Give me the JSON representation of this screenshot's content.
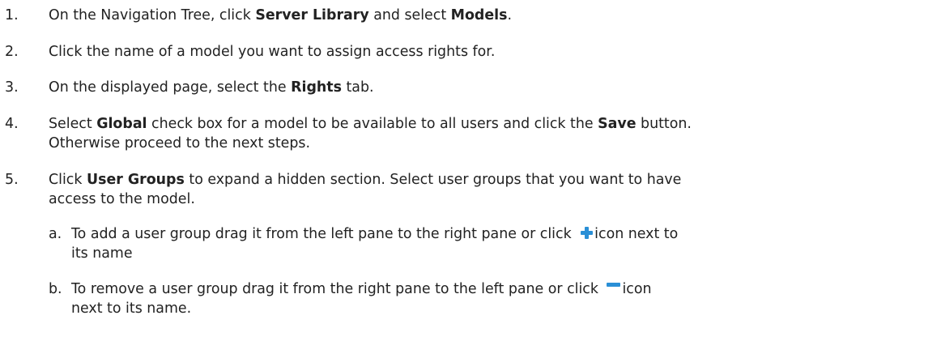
{
  "steps": [
    {
      "number": "1.",
      "parts": [
        "On the Navigation Tree, click ",
        "Server Library",
        " and select ",
        "Models",
        "."
      ]
    },
    {
      "number": "2.",
      "text": "Click the name of a model you want to assign access rights for."
    },
    {
      "number": "3.",
      "parts": [
        "On the displayed page, select the ",
        "Rights",
        " tab."
      ]
    },
    {
      "number": "4.",
      "parts": [
        "Select ",
        "Global",
        " check box for a model to be available to all users and click the ",
        "Save",
        " button."
      ],
      "continuation": "Otherwise proceed to the next steps."
    },
    {
      "number": "5.",
      "parts": [
        "Click ",
        "User Groups",
        " to expand a hidden section. Select user groups that you want to have"
      ],
      "continuation": "access to the model."
    }
  ],
  "substeps": [
    {
      "letter": "a.",
      "before_icon": "To add a user group drag it from the left pane to the right pane or click ",
      "icon": "plus-icon",
      "after_icon": "icon next to",
      "continuation": "its name"
    },
    {
      "letter": "b.",
      "before_icon": "To remove a user group drag it from the right pane to the left  pane or click ",
      "icon": "minus-icon",
      "after_icon": "icon",
      "continuation": "next to its name."
    }
  ],
  "colors": {
    "text": "#222222",
    "icon_blue": "#2a8fd6",
    "background": "#ffffff"
  }
}
